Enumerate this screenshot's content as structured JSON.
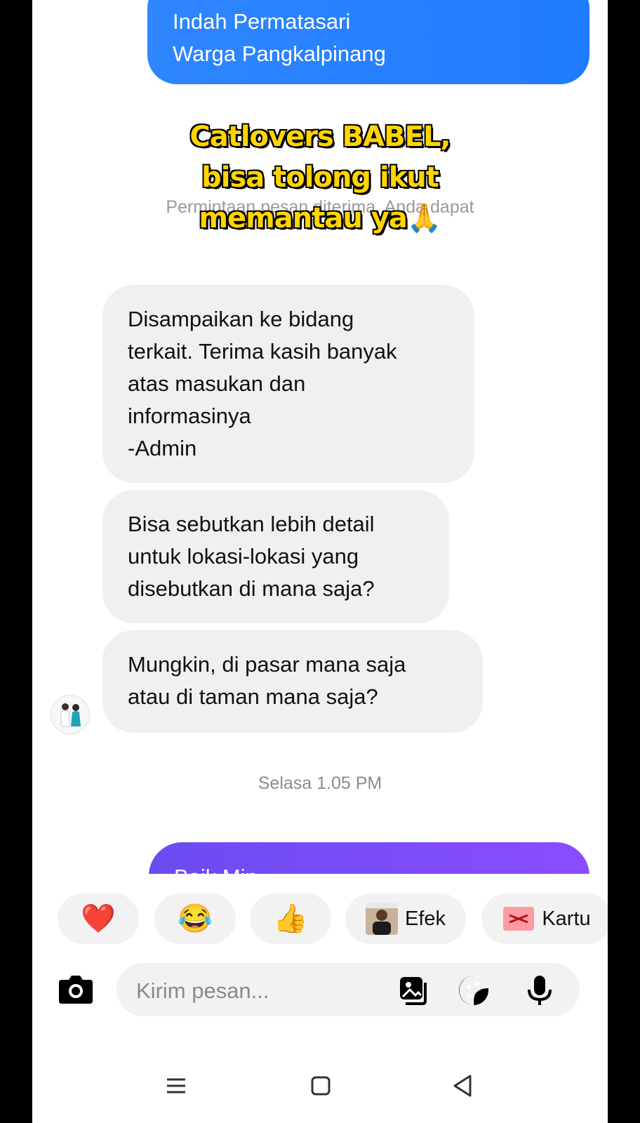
{
  "outgoing_top": {
    "lines": [
      "Indah Permatasari",
      "Warga Pangkalpinang"
    ]
  },
  "request_notice": {
    "text": "Permintaan pesan diterima. Anda dapat"
  },
  "overlay_caption": {
    "line1": "Catlovers BABEL,",
    "line2": "bisa tolong ikut",
    "line3": "memantau ya",
    "emoji": "🙏"
  },
  "incoming_messages": [
    {
      "lines": [
        "Disampaikan ke bidang",
        "terkait. Terima kasih banyak",
        "atas masukan dan",
        "informasinya",
        "-Admin"
      ]
    },
    {
      "lines": [
        "Bisa sebutkan lebih detail",
        "untuk lokasi-lokasi yang",
        "disebutkan di mana saja?"
      ]
    },
    {
      "lines": [
        "Mungkin, di pasar mana saja",
        "atau di taman mana saja?"
      ]
    }
  ],
  "timestamp": "Selasa 1.05 PM",
  "outgoing_bottom": {
    "text": "Baik Min"
  },
  "quick_reactions": {
    "heart": "❤️",
    "laugh": "😂",
    "thumbs": "👍",
    "effect_label": "Efek",
    "card_label": "Kartu"
  },
  "composer": {
    "placeholder": "Kirim pesan..."
  },
  "icons": {
    "camera": "camera-icon",
    "gallery": "gallery-icon",
    "sticker": "sticker-icon",
    "mic": "microphone-icon",
    "menu": "menu-icon",
    "home": "home-icon",
    "back": "back-icon"
  },
  "colors": {
    "outgoing_blue": "#1f7bff",
    "outgoing_purple": "#7b4df8",
    "incoming_bg": "#f0f0f0",
    "caption_yellow": "#ffd400"
  }
}
